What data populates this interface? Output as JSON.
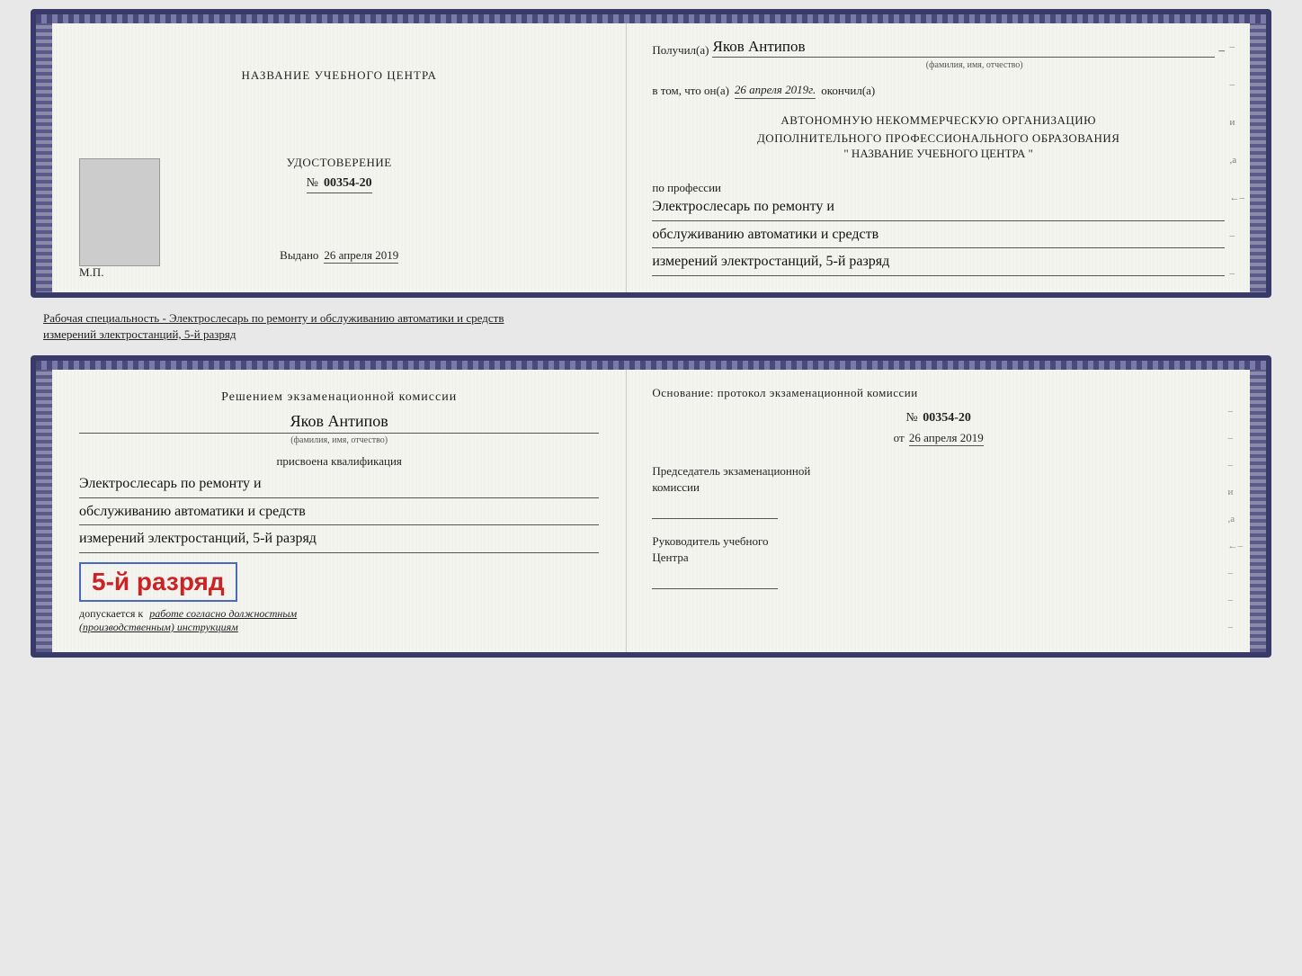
{
  "topDoc": {
    "leftPanel": {
      "title": "НАЗВАНИЕ УЧЕБНОГО ЦЕНТРА",
      "certLabel": "УДОСТОВЕРЕНИЕ",
      "certNumberPrefix": "№",
      "certNumber": "00354-20",
      "issuedLabel": "Выдано",
      "issuedDate": "26 апреля 2019",
      "mpLabel": "М.П."
    },
    "rightPanel": {
      "receivedLabel": "Получил(а)",
      "receivedName": "Яков Антипов",
      "nameSubtitle": "(фамилия, имя, отчество)",
      "certifiesLabel": "в том, что он(а)",
      "certifiesDate": "26 апреля 2019г.",
      "certifiesEnd": "окончил(а)",
      "orgLine1": "АВТОНОМНУЮ НЕКОММЕРЧЕСКУЮ ОРГАНИЗАЦИЮ",
      "orgLine2": "ДОПОЛНИТЕЛЬНОГО ПРОФЕССИОНАЛЬНОГО ОБРАЗОВАНИЯ",
      "orgName": "\"  НАЗВАНИЕ УЧЕБНОГО ЦЕНТРА  \"",
      "professionLabel": "по профессии",
      "professionLine1": "Электрослесарь по ремонту и",
      "professionLine2": "обслуживанию автоматики и средств",
      "professionLine3": "измерений электростанций, 5-й разряд"
    }
  },
  "middleText": "Рабочая специальность - Электрослесарь по ремонту и обслуживанию автоматики и средств\nизмерений электростанций, 5-й разряд",
  "bottomDoc": {
    "leftPanel": {
      "commissionLine1": "Решением экзаменационной комиссии",
      "personName": "Яков Антипов",
      "nameSubtitle": "(фамилия, имя, отчество)",
      "qualificationLabel": "присвоена квалификация",
      "qualLine1": "Электрослесарь по ремонту и",
      "qualLine2": "обслуживанию автоматики и средств",
      "qualLine3": "измерений электростанций, 5-й разряд",
      "rankText": "5-й разряд",
      "allowedLabel": "допускается к",
      "allowedText": "работе согласно должностным",
      "allowedText2": "(производственным) инструкциям"
    },
    "rightPanel": {
      "basisLine1": "Основание: протокол экзаменационной комиссии",
      "basisNumberPrefix": "№",
      "basisNumber": "00354-20",
      "basisDatePrefix": "от",
      "basisDate": "26 апреля 2019",
      "chairmanLine1": "Председатель экзаменационной",
      "chairmanLine2": "комиссии",
      "directorLine1": "Руководитель учебного",
      "directorLine2": "Центра"
    }
  }
}
